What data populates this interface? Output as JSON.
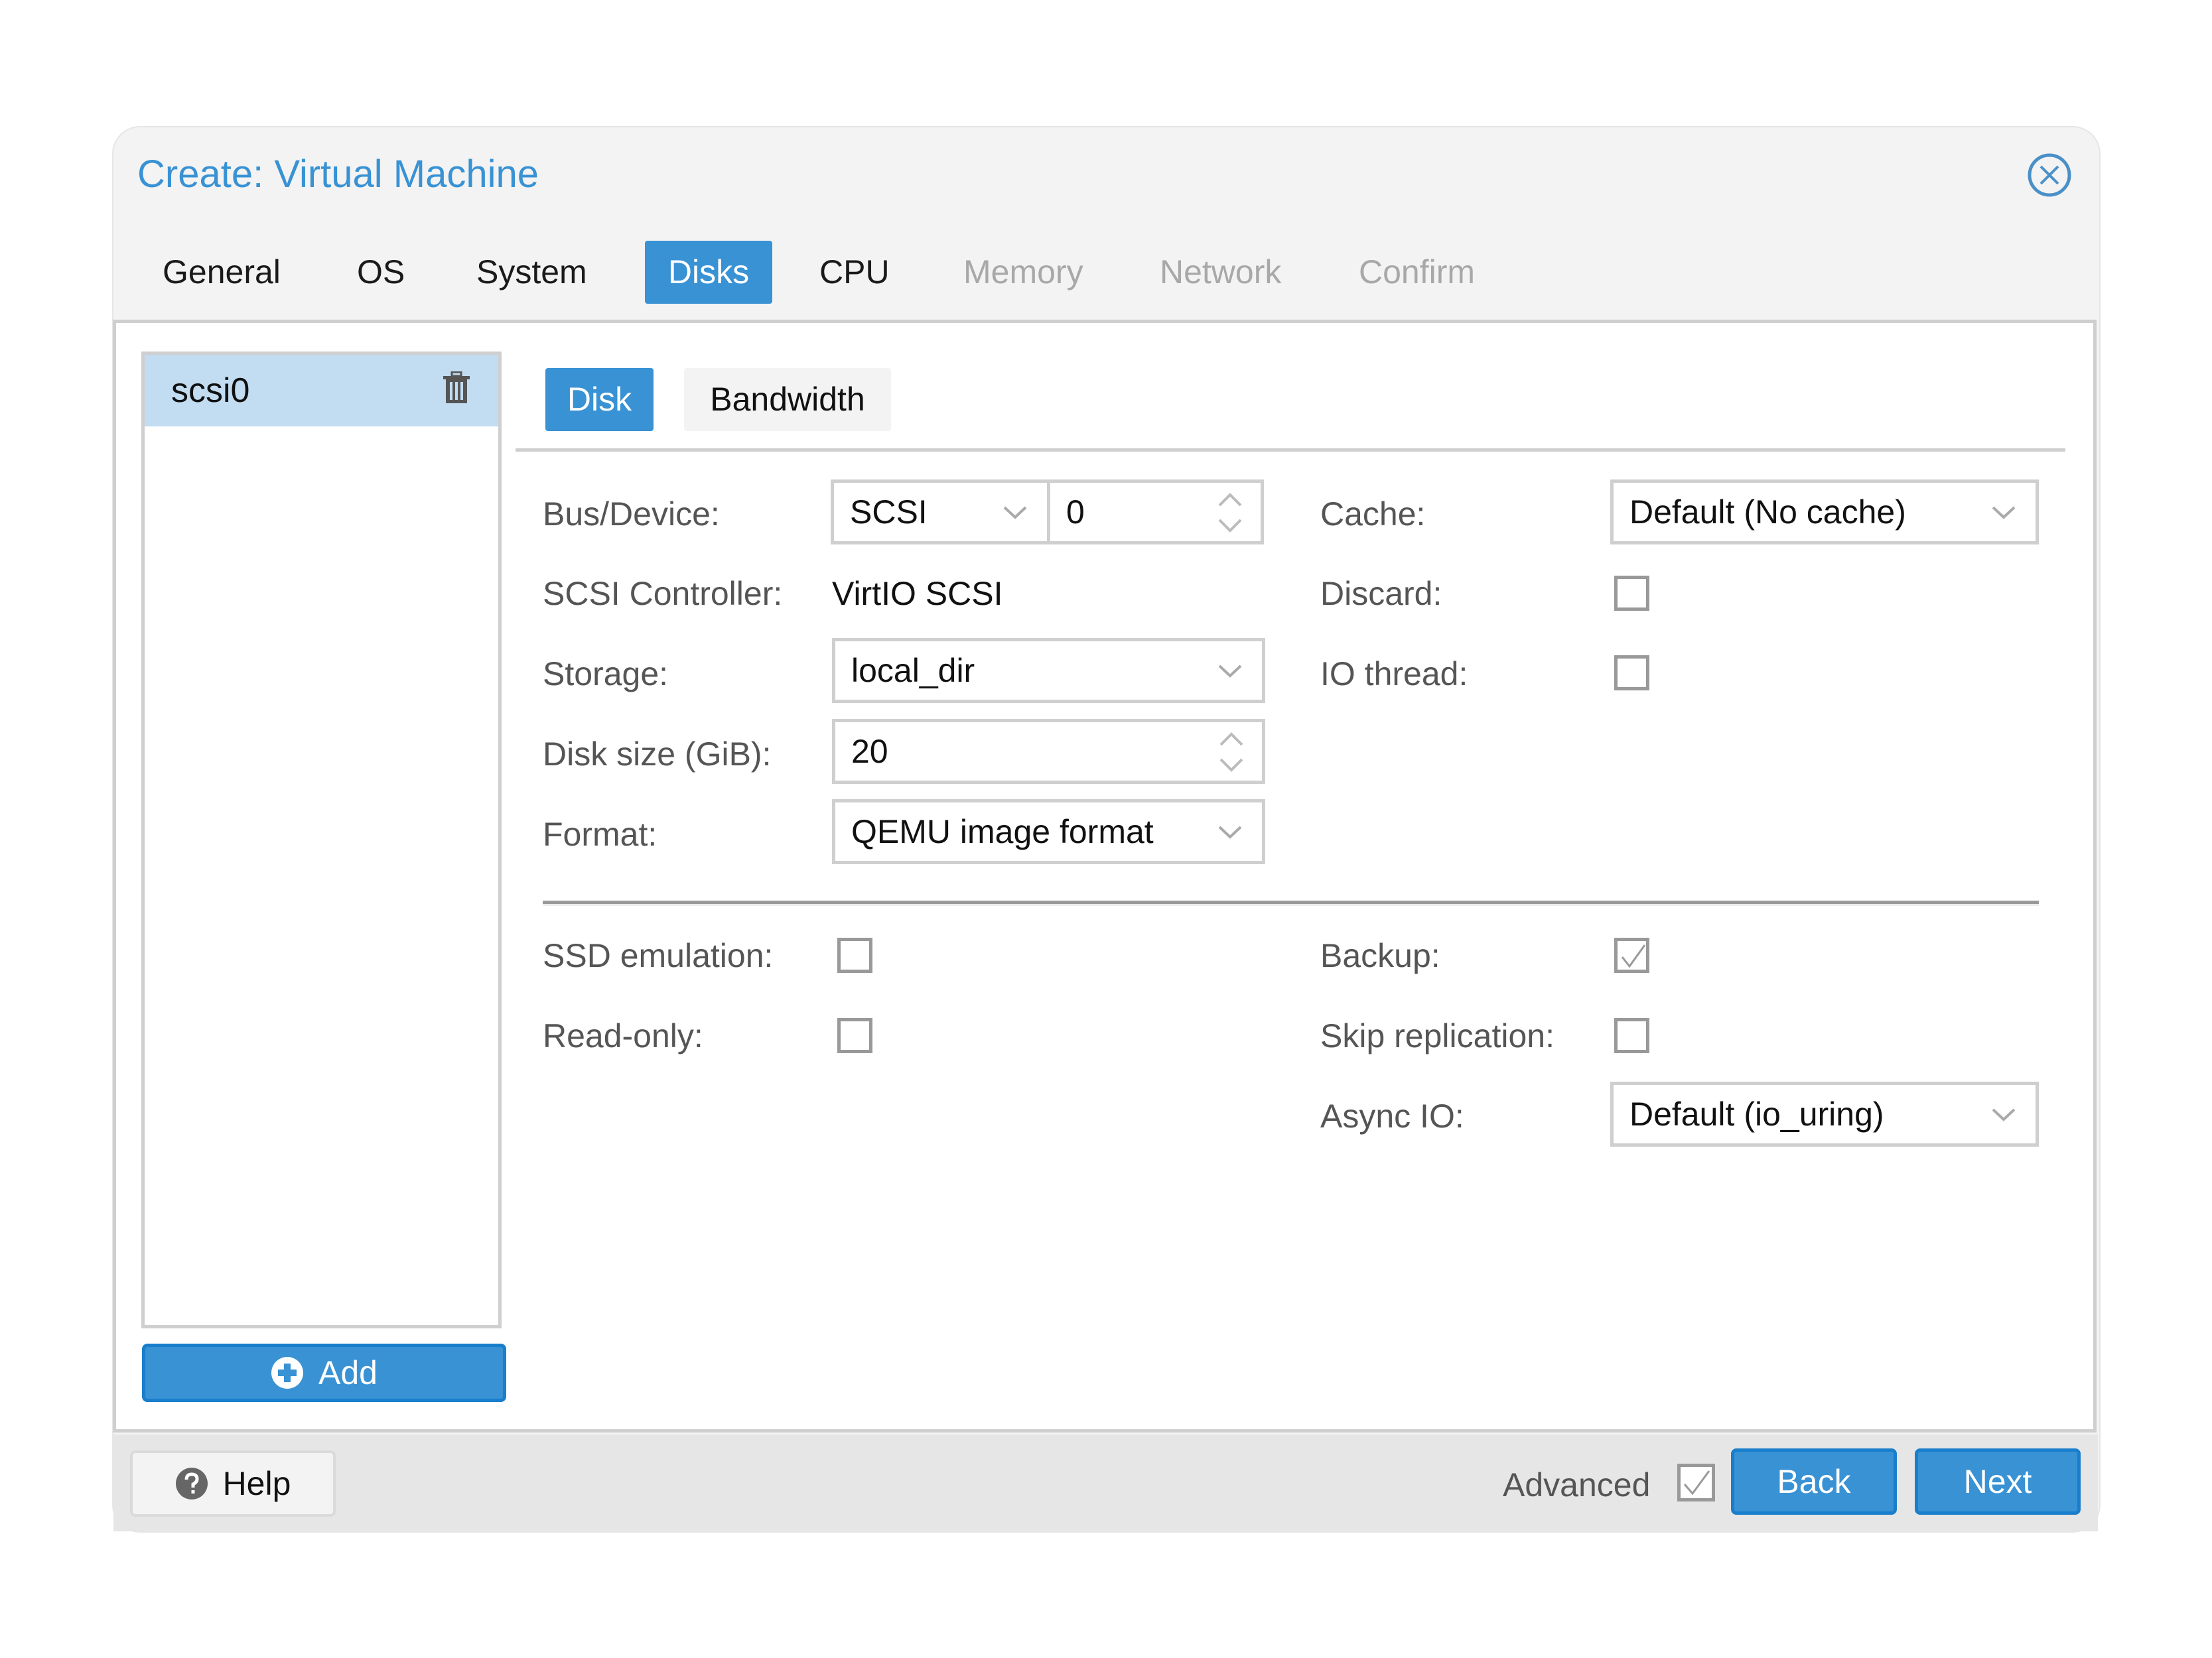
{
  "window": {
    "title": "Create: Virtual Machine",
    "close_icon": "circle-x-icon"
  },
  "wizard_tabs": [
    {
      "label": "General",
      "state": "normal"
    },
    {
      "label": "OS",
      "state": "normal"
    },
    {
      "label": "System",
      "state": "normal"
    },
    {
      "label": "Disks",
      "state": "active"
    },
    {
      "label": "CPU",
      "state": "normal"
    },
    {
      "label": "Memory",
      "state": "disabled"
    },
    {
      "label": "Network",
      "state": "disabled"
    },
    {
      "label": "Confirm",
      "state": "disabled"
    }
  ],
  "disk_list": {
    "items": [
      {
        "label": "scsi0",
        "selected": true,
        "icon": "trash-icon"
      }
    ],
    "add_button": {
      "label": "Add",
      "icon": "plus-circle-icon"
    }
  },
  "sub_tabs": [
    {
      "label": "Disk",
      "active": true
    },
    {
      "label": "Bandwidth",
      "active": false
    }
  ],
  "form": {
    "bus_device": {
      "label": "Bus/Device:",
      "bus": "SCSI",
      "device": "0"
    },
    "scsi_controller": {
      "label": "SCSI Controller:",
      "value": "VirtIO SCSI"
    },
    "storage": {
      "label": "Storage:",
      "value": "local_dir"
    },
    "disk_size": {
      "label": "Disk size (GiB):",
      "value": "20"
    },
    "format": {
      "label": "Format:",
      "value": "QEMU image format"
    },
    "cache": {
      "label": "Cache:",
      "value": "Default (No cache)"
    },
    "discard": {
      "label": "Discard:",
      "checked": false
    },
    "io_thread": {
      "label": "IO thread:",
      "checked": false
    },
    "ssd_emulation": {
      "label": "SSD emulation:",
      "checked": false
    },
    "read_only": {
      "label": "Read-only:",
      "checked": false
    },
    "backup": {
      "label": "Backup:",
      "checked": true
    },
    "skip_replication": {
      "label": "Skip replication:",
      "checked": false
    },
    "async_io": {
      "label": "Async IO:",
      "value": "Default (io_uring)"
    }
  },
  "footer": {
    "help_label": "Help",
    "help_icon": "question-circle-icon",
    "advanced_label": "Advanced",
    "advanced_checked": true,
    "back_label": "Back",
    "next_label": "Next"
  },
  "colors": {
    "accent": "#3892d4",
    "accent_border": "#197ecb",
    "selected_row": "#c2dcf1",
    "header_bg": "#f3f3f3",
    "footer_bg": "#e6e6e6",
    "disabled_text": "#a8a8a8"
  }
}
